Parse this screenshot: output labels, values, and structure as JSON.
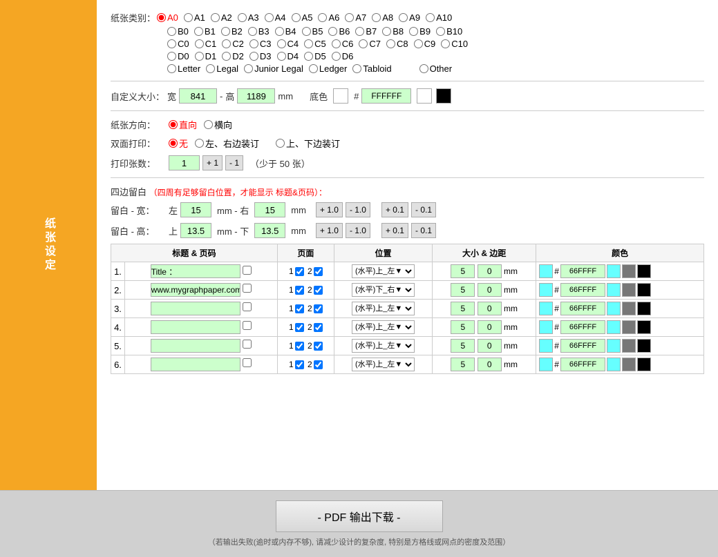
{
  "sidebar": {
    "label": "纸张设定"
  },
  "paper_type": {
    "label": "纸张类别：",
    "options_a": [
      "A0",
      "A1",
      "A2",
      "A3",
      "A4",
      "A5",
      "A6",
      "A7",
      "A8",
      "A9",
      "A10"
    ],
    "options_b": [
      "B0",
      "B1",
      "B2",
      "B3",
      "B4",
      "B5",
      "B6",
      "B7",
      "B8",
      "B9",
      "B10"
    ],
    "options_c": [
      "C0",
      "C1",
      "C2",
      "C3",
      "C4",
      "C5",
      "C6",
      "C7",
      "C8",
      "C9",
      "C10"
    ],
    "options_d": [
      "D0",
      "D1",
      "D2",
      "D3",
      "D4",
      "D5",
      "D6"
    ],
    "options_special": [
      "Letter",
      "Legal",
      "Junior Legal",
      "Ledger",
      "Tabloid",
      "Other"
    ],
    "selected": "A0"
  },
  "custom_size": {
    "label": "自定义大小：",
    "width_label": "宽",
    "width_value": "841",
    "dash": "-",
    "height_label": "高",
    "height_value": "1189",
    "unit": "mm",
    "bg_color_label": "底色",
    "hash": "#",
    "hex_value": "FFFFFF"
  },
  "orientation": {
    "label": "纸张方向：",
    "portrait_label": "直向",
    "landscape_label": "横向",
    "selected": "portrait"
  },
  "duplex": {
    "label": "双面打印：",
    "none_label": "无",
    "lr_label": "左、右边装订",
    "tb_label": "上、下边装订",
    "selected": "none"
  },
  "print_count": {
    "label": "打印张数：",
    "value": "1",
    "btn_plus": "+ 1",
    "btn_minus": "- 1",
    "note": "（少于 50 张）"
  },
  "margin_section": {
    "title": "四边留白",
    "note": "（四周有足够留白位置，才能显示 标题&页码）：",
    "width_label": "留白 - 宽：",
    "left_label": "左",
    "left_value": "15",
    "unit1": "mm - 右",
    "right_value": "15",
    "unit2": "mm",
    "height_label": "留白 - 高：",
    "top_label": "上",
    "top_value": "13.5",
    "unit3": "mm - 下",
    "bottom_value": "13.5",
    "unit4": "mm",
    "btn_plus10": "+ 1.0",
    "btn_minus10": "- 1.0",
    "btn_plus01": "+ 0.1",
    "btn_minus01": "- 0.1"
  },
  "header_table": {
    "columns": [
      "标题 & 页码",
      "页面",
      "位置",
      "大小 & 边距",
      "颜色"
    ],
    "rows": [
      {
        "num": "1.",
        "title_value": "Title ：",
        "page1_checked": true,
        "page2_checked": true,
        "position": "(水平)上_左▼",
        "size": "5",
        "margin": "0",
        "unit": "mm",
        "hash": "#",
        "hex": "66FFFF"
      },
      {
        "num": "2.",
        "title_value": "www.mygraphpaper.com",
        "page1_checked": true,
        "page2_checked": true,
        "position": "(水平)下_右▼",
        "size": "5",
        "margin": "0",
        "unit": "mm",
        "hash": "#",
        "hex": "66FFFF"
      },
      {
        "num": "3.",
        "title_value": "",
        "page1_checked": true,
        "page2_checked": true,
        "position": "(水平)上_左▼",
        "size": "5",
        "margin": "0",
        "unit": "mm",
        "hash": "#",
        "hex": "66FFFF"
      },
      {
        "num": "4.",
        "title_value": "",
        "page1_checked": true,
        "page2_checked": true,
        "position": "(水平)上_左▼",
        "size": "5",
        "margin": "0",
        "unit": "mm",
        "hash": "#",
        "hex": "66FFFF"
      },
      {
        "num": "5.",
        "title_value": "",
        "page1_checked": true,
        "page2_checked": true,
        "position": "(水平)上_左▼",
        "size": "5",
        "margin": "0",
        "unit": "mm",
        "hash": "#",
        "hex": "66FFFF"
      },
      {
        "num": "6.",
        "title_value": "",
        "page1_checked": true,
        "page2_checked": true,
        "position": "(水平)上_左▼",
        "size": "5",
        "margin": "0",
        "unit": "mm",
        "hash": "#",
        "hex": "66FFFF"
      }
    ]
  },
  "bottom": {
    "pdf_btn_label": "- PDF 输出下载 -",
    "note": "（若输出失败(逾时或内存不够), 请减少设计的复杂度, 特别是方格线或网点的密度及范围）"
  }
}
